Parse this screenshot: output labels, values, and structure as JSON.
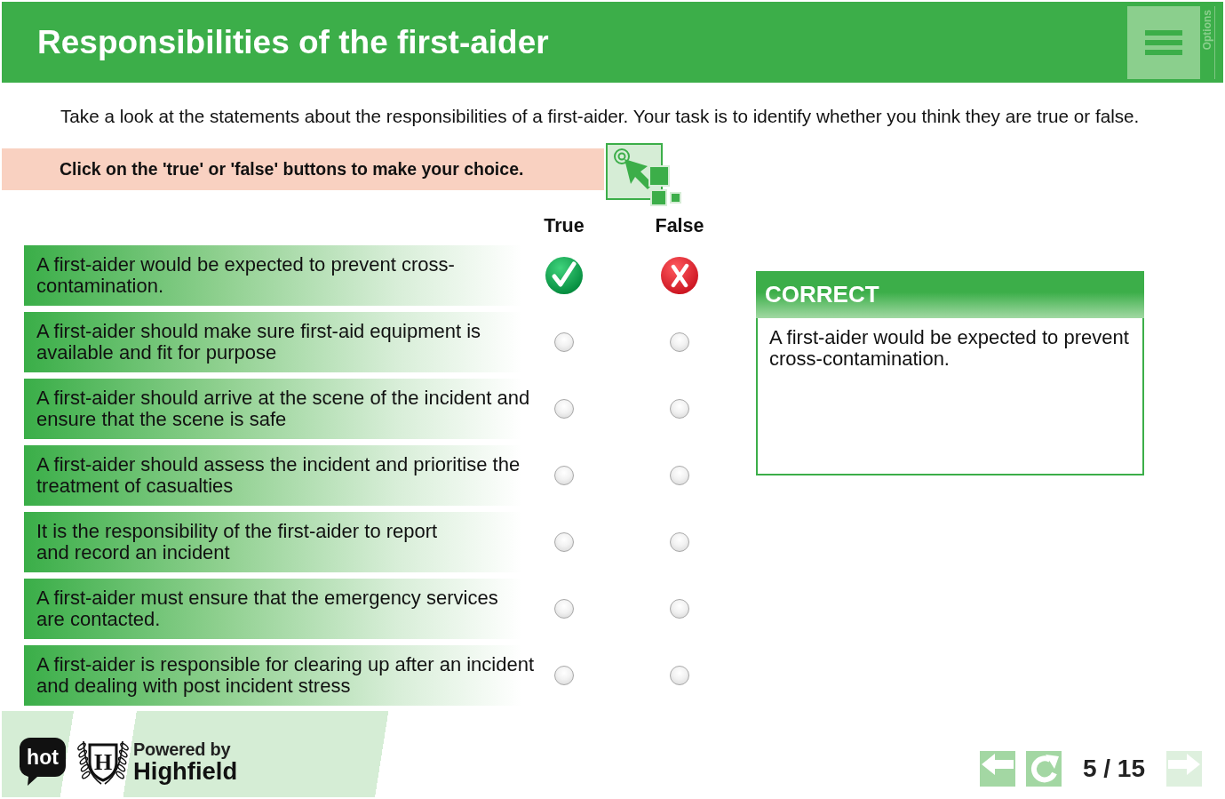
{
  "header": {
    "title": "Responsibilities of the first-aider",
    "side_label": "Options"
  },
  "intro": "Take a look at the statements about the responsibilities of a first-aider. Your task is to identify whether you think they are true or false.",
  "instruction": "Click on the 'true' or 'false' buttons to make your choice.",
  "columns": [
    "True",
    "False"
  ],
  "statements": [
    {
      "text": "A first-aider would be expected to prevent cross-contamination.",
      "options": [
        {
          "kind": "tick"
        },
        {
          "kind": "cross"
        }
      ]
    },
    {
      "text": "A first-aider should make sure first-aid equipment is\navailable and fit for purpose",
      "options": [
        {
          "kind": "radio",
          "selected": false
        },
        {
          "kind": "radio",
          "selected": false
        }
      ]
    },
    {
      "text": "A first-aider should arrive at the scene of the incident and\nensure that the scene is safe",
      "options": [
        {
          "kind": "radio",
          "selected": false
        },
        {
          "kind": "radio",
          "selected": false
        }
      ]
    },
    {
      "text": "A first-aider should assess the incident and prioritise the\ntreatment of casualties",
      "options": [
        {
          "kind": "radio",
          "selected": false
        },
        {
          "kind": "radio",
          "selected": false
        }
      ]
    },
    {
      "text": "It is the responsibility of the first-aider to report\nand record an incident",
      "options": [
        {
          "kind": "radio",
          "selected": false
        },
        {
          "kind": "radio",
          "selected": false
        }
      ]
    },
    {
      "text": "A first-aider must ensure that the emergency services\nare contacted.",
      "options": [
        {
          "kind": "radio",
          "selected": false
        },
        {
          "kind": "radio",
          "selected": false
        }
      ]
    },
    {
      "text": "A first-aider is responsible for clearing up after an incident\nand dealing with post incident stress",
      "options": [
        {
          "kind": "radio",
          "selected": false
        },
        {
          "kind": "radio",
          "selected": false
        }
      ]
    }
  ],
  "feedback": {
    "title": "CORRECT",
    "text": "A first-aider would be expected to prevent cross-contamination."
  },
  "footer": {
    "hot_logo": "hot",
    "crest_letter": "H",
    "powered_by": "Powered by",
    "brand": "Highfield",
    "nav": [
      {
        "kind": "back",
        "disabled": false
      },
      {
        "kind": "replay",
        "disabled": false
      },
      {
        "kind": "next",
        "disabled": true
      }
    ],
    "page": "5 / 15"
  }
}
